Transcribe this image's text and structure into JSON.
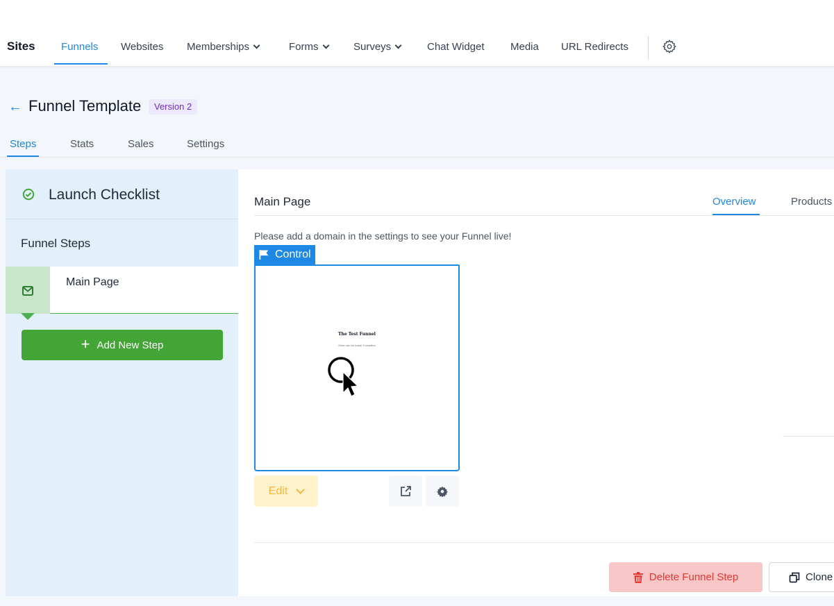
{
  "topnav": {
    "brand": "Sites",
    "items": [
      {
        "label": "Funnels",
        "active": true
      },
      {
        "label": "Websites"
      },
      {
        "label": "Memberships",
        "dropdown": true
      },
      {
        "label": "Forms",
        "dropdown": true
      },
      {
        "label": "Surveys",
        "dropdown": true
      },
      {
        "label": "Chat Widget"
      },
      {
        "label": "Media"
      },
      {
        "label": "URL Redirects"
      }
    ],
    "settings_icon": "gear-icon"
  },
  "header": {
    "back_icon": "arrow-left-icon",
    "title": "Funnel Template",
    "version_badge": "Version 2",
    "tabs": [
      {
        "label": "Steps",
        "active": true
      },
      {
        "label": "Stats"
      },
      {
        "label": "Sales"
      },
      {
        "label": "Settings"
      }
    ]
  },
  "sidebar": {
    "checklist_label": "Launch Checklist",
    "steps_heading": "Funnel Steps",
    "steps": [
      {
        "label": "Main Page",
        "icon": "envelope-icon",
        "selected": true
      }
    ],
    "add_step_label": "Add New Step"
  },
  "main": {
    "title": "Main Page",
    "tabs": [
      {
        "label": "Overview",
        "active": true
      },
      {
        "label": "Products"
      }
    ],
    "domain_note": "Please add a domain in the settings to see your Funnel live!",
    "variant": {
      "tag": "Control",
      "tag_icon": "flag-icon",
      "preview_title": "The Test Funnel",
      "preview_subtitle": "Enter can be made 3 headline"
    },
    "edit_label": "Edit",
    "delete_label": "Delete Funnel Step",
    "clone_label": "Clone"
  },
  "colors": {
    "accent": "#1e88e5",
    "success": "#43a535",
    "warning": "#f5b83d",
    "danger": "#e53935",
    "badge": "#6d28d9"
  }
}
